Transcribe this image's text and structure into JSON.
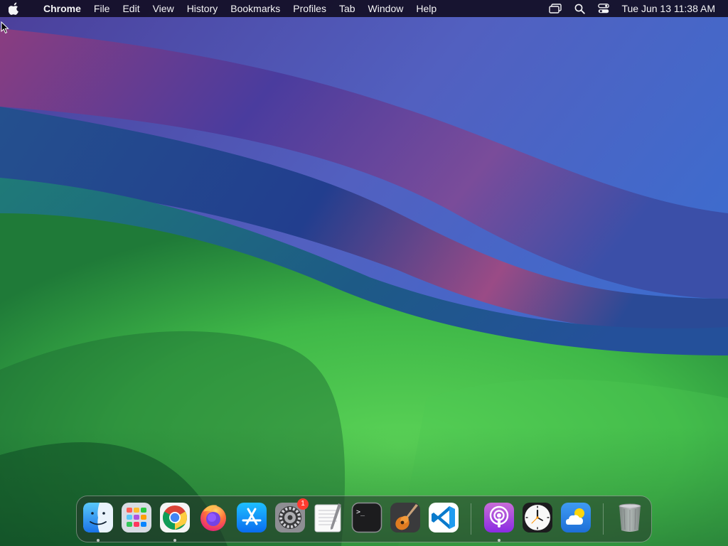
{
  "menubar": {
    "app_name": "Chrome",
    "menus": [
      "File",
      "Edit",
      "View",
      "History",
      "Bookmarks",
      "Profiles",
      "Tab",
      "Window",
      "Help"
    ],
    "clock": "Tue Jun 13  11:38 AM",
    "status_icons": [
      "screen-mirroring-icon",
      "spotlight-search-icon",
      "control-center-icon"
    ]
  },
  "dock": {
    "items": [
      {
        "name": "finder",
        "running": true
      },
      {
        "name": "launchpad",
        "running": false
      },
      {
        "name": "google-chrome",
        "running": true
      },
      {
        "name": "firefox",
        "running": false
      },
      {
        "name": "app-store",
        "running": false
      },
      {
        "name": "system-settings",
        "running": false,
        "badge": "1"
      },
      {
        "name": "textedit",
        "running": false
      },
      {
        "name": "terminal",
        "running": false
      },
      {
        "name": "garageband",
        "running": false
      },
      {
        "name": "visual-studio-code",
        "running": false
      },
      {
        "name": "podcasts",
        "running": true
      },
      {
        "name": "clock",
        "running": false
      },
      {
        "name": "weather",
        "running": false
      },
      {
        "name": "trash",
        "running": false
      }
    ],
    "terminal_prompt": ">_"
  },
  "colors": {
    "menubar_bg": "#120e24",
    "badge": "#ff3b30",
    "wallpaper_green": "#3fbf4a",
    "wallpaper_purple": "#5a4fb0",
    "wallpaper_blue": "#3e66c8"
  }
}
